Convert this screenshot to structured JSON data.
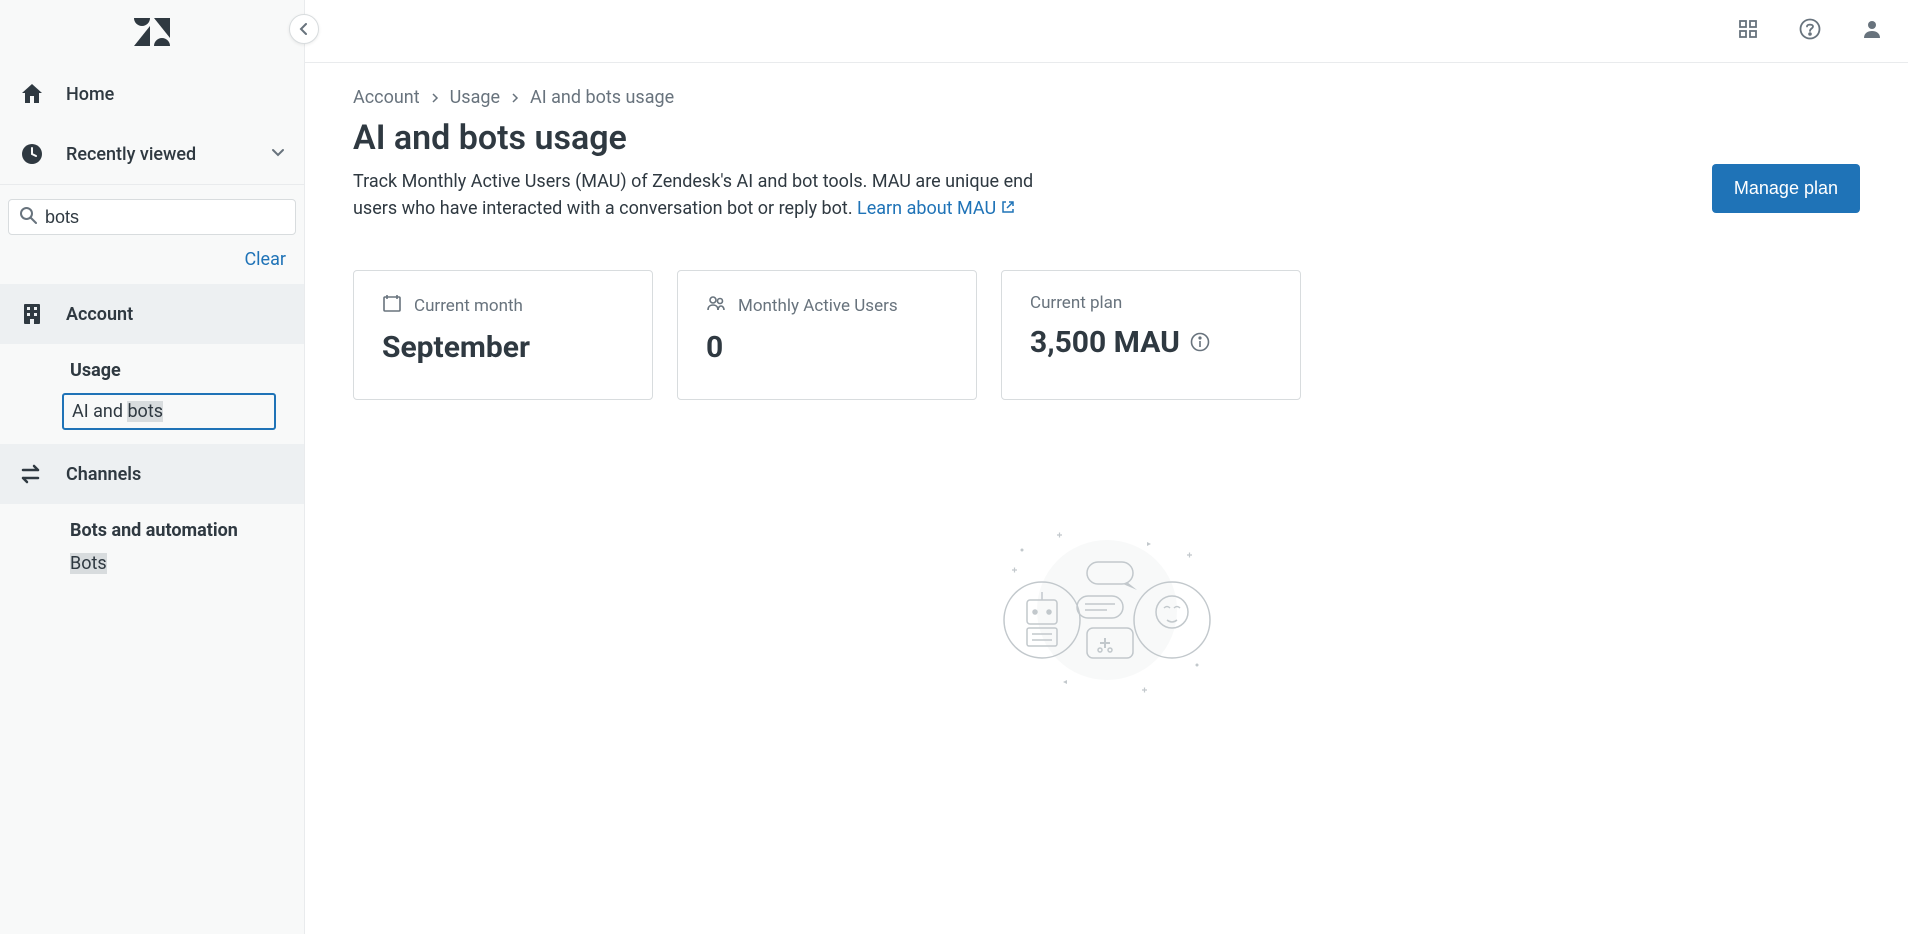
{
  "sidebar": {
    "home_label": "Home",
    "recently_viewed_label": "Recently viewed",
    "search_value": "bots",
    "clear_label": "Clear",
    "account_label": "Account",
    "usage_label": "Usage",
    "ai_bots_prefix": "AI and ",
    "ai_bots_highlight": "bots",
    "channels_label": "Channels",
    "bots_automation_label": "Bots and automation",
    "bots_label": "Bots"
  },
  "breadcrumb": {
    "account": "Account",
    "usage": "Usage",
    "current": "AI and bots usage"
  },
  "page": {
    "title": "AI and bots usage",
    "description": "Track Monthly Active Users (MAU) of Zendesk's AI and bot tools. MAU are unique end users who have interacted with a conversation bot or reply bot. ",
    "learn_link": "Learn about MAU",
    "manage_button": "Manage plan"
  },
  "cards": {
    "current_month_label": "Current month",
    "current_month_value": "September",
    "mau_label": "Monthly Active Users",
    "mau_value": "0",
    "plan_label": "Current plan",
    "plan_value": "3,500 MAU"
  }
}
